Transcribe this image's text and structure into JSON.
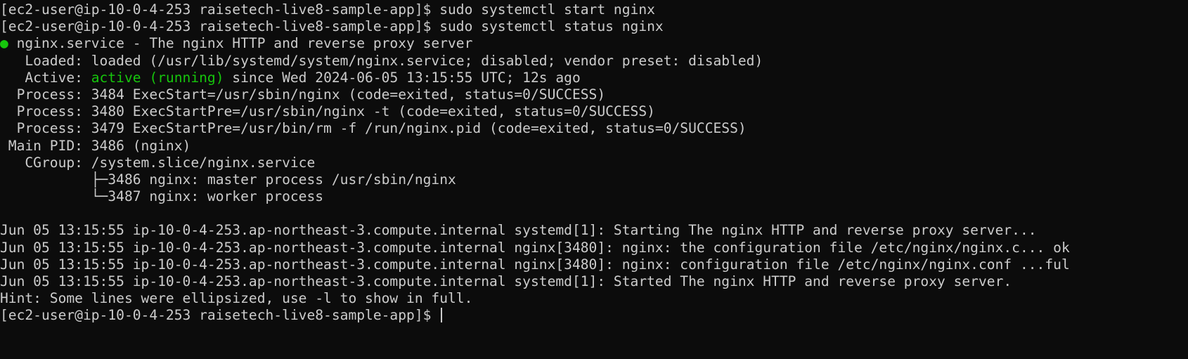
{
  "terminal": {
    "colors": {
      "background": "#0c0c0c",
      "foreground": "#cccccc",
      "accent_green": "#16c60c"
    },
    "lines": {
      "cmd1": "[ec2-user@ip-10-0-4-253 raisetech-live8-sample-app]$ sudo systemctl start nginx",
      "cmd2": "[ec2-user@ip-10-0-4-253 raisetech-live8-sample-app]$ sudo systemctl status nginx",
      "service_dot": "●",
      "service_name": " nginx.service - The nginx HTTP and reverse proxy server",
      "loaded": "   Loaded: loaded (/usr/lib/systemd/system/nginx.service; disabled; vendor preset: disabled)",
      "active_label": "   Active: ",
      "active_state": "active (running)",
      "active_since": " since Wed 2024-06-05 13:15:55 UTC; 12s ago",
      "process1": "  Process: 3484 ExecStart=/usr/sbin/nginx (code=exited, status=0/SUCCESS)",
      "process2": "  Process: 3480 ExecStartPre=/usr/sbin/nginx -t (code=exited, status=0/SUCCESS)",
      "process3": "  Process: 3479 ExecStartPre=/usr/bin/rm -f /run/nginx.pid (code=exited, status=0/SUCCESS)",
      "main_pid": " Main PID: 3486 (nginx)",
      "cgroup": "   CGroup: /system.slice/nginx.service",
      "cgroup_child1": "           ├─3486 nginx: master process /usr/sbin/nginx",
      "cgroup_child2": "           └─3487 nginx: worker process",
      "log1": "Jun 05 13:15:55 ip-10-0-4-253.ap-northeast-3.compute.internal systemd[1]: Starting The nginx HTTP and reverse proxy server...",
      "log2": "Jun 05 13:15:55 ip-10-0-4-253.ap-northeast-3.compute.internal nginx[3480]: nginx: the configuration file /etc/nginx/nginx.c... ok",
      "log3": "Jun 05 13:15:55 ip-10-0-4-253.ap-northeast-3.compute.internal nginx[3480]: nginx: configuration file /etc/nginx/nginx.conf ...ful",
      "log4": "Jun 05 13:15:55 ip-10-0-4-253.ap-northeast-3.compute.internal systemd[1]: Started The nginx HTTP and reverse proxy server.",
      "hint": "Hint: Some lines were ellipsized, use -l to show in full.",
      "prompt": "[ec2-user@ip-10-0-4-253 raisetech-live8-sample-app]$ "
    }
  }
}
